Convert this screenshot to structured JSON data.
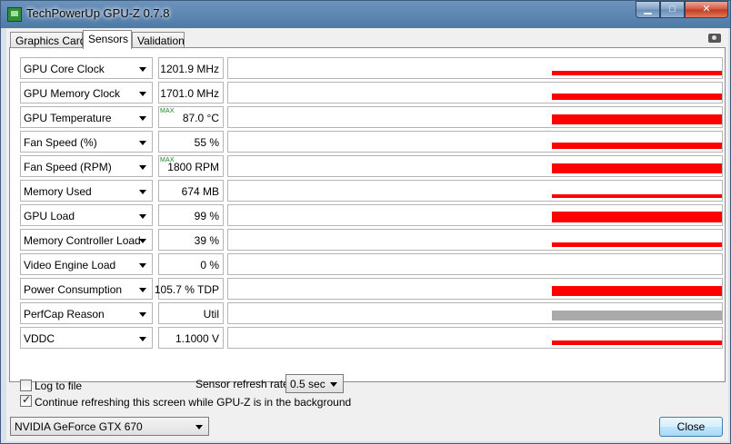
{
  "window": {
    "title": "TechPowerUp GPU-Z 0.7.8"
  },
  "tabs": [
    {
      "label": "Graphics Card"
    },
    {
      "label": "Sensors"
    },
    {
      "label": "Validation"
    }
  ],
  "colors": {
    "graph_bar": "#ff0000",
    "graph_bar_inactive": "#aaaaaa"
  },
  "sensors": [
    {
      "name": "GPU Core Clock",
      "value": "1201.9 MHz",
      "max": false,
      "level": 0.45,
      "color": "#ff0000"
    },
    {
      "name": "GPU Memory Clock",
      "value": "1701.0 MHz",
      "max": false,
      "level": 0.55,
      "color": "#ff0000"
    },
    {
      "name": "GPU Temperature",
      "value": "87.0 °C",
      "max": true,
      "max_label": "MAX",
      "level": 0.9,
      "color": "#ff0000"
    },
    {
      "name": "Fan Speed (%)",
      "value": "55 %",
      "max": false,
      "level": 0.55,
      "color": "#ff0000"
    },
    {
      "name": "Fan Speed (RPM)",
      "value": "1800 RPM",
      "max": true,
      "max_label": "MAX",
      "level": 0.9,
      "color": "#ff0000"
    },
    {
      "name": "Memory Used",
      "value": "674 MB",
      "max": false,
      "level": 0.35,
      "color": "#ff0000"
    },
    {
      "name": "GPU Load",
      "value": "99 %",
      "max": false,
      "level": 0.99,
      "color": "#ff0000"
    },
    {
      "name": "Memory Controller Load",
      "value": "39 %",
      "max": false,
      "level": 0.39,
      "color": "#ff0000"
    },
    {
      "name": "Video Engine Load",
      "value": "0 %",
      "max": false,
      "level": 0,
      "color": "#ff0000"
    },
    {
      "name": "Power Consumption",
      "value": "105.7 % TDP",
      "max": false,
      "level": 0.9,
      "color": "#ff0000"
    },
    {
      "name": "PerfCap Reason",
      "value": "Util",
      "max": false,
      "level": 0.9,
      "color": "#aaaaaa"
    },
    {
      "name": "VDDC",
      "value": "1.1000 V",
      "max": false,
      "level": 0.45,
      "color": "#ff0000"
    }
  ],
  "footer": {
    "log_to_file": {
      "label": "Log to file",
      "checked": false
    },
    "refresh_rate_label": "Sensor refresh rate:",
    "refresh_rate_value": "0.5 sec",
    "continue_refresh": {
      "label": "Continue refreshing this screen while GPU-Z is in the background",
      "checked": true
    },
    "gpu_select": "NVIDIA GeForce GTX 670",
    "close_label": "Close"
  }
}
